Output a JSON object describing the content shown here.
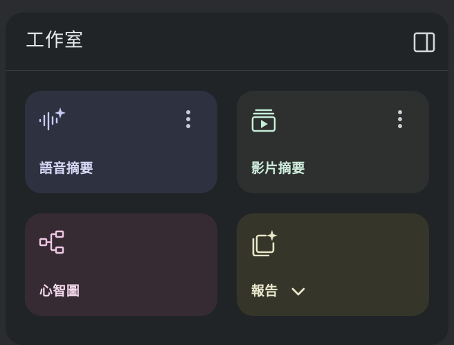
{
  "panel": {
    "title": "工作室",
    "toggle_icon": "side-panel-icon"
  },
  "cards": [
    {
      "id": "audio",
      "label": "語音摘要",
      "icon": "audio-sparkle-icon",
      "accent": "#c5cbf5",
      "background": "#2e3140"
    },
    {
      "id": "video",
      "label": "影片摘要",
      "icon": "video-collection-icon",
      "accent": "#c5ecd6",
      "background": "#2d302e"
    },
    {
      "id": "mindmap",
      "label": "心智圖",
      "icon": "mind-map-icon",
      "accent": "#f0c8e4",
      "background": "#372b33"
    },
    {
      "id": "report",
      "label": "報告",
      "icon": "report-sparkle-icon",
      "accent": "#e8e6c8",
      "background": "#353529"
    }
  ],
  "colors": {
    "page_background": "#2a2c2f",
    "panel_background": "#202427",
    "title_text": "#e6e8ea",
    "divider": "#3a3f43"
  }
}
